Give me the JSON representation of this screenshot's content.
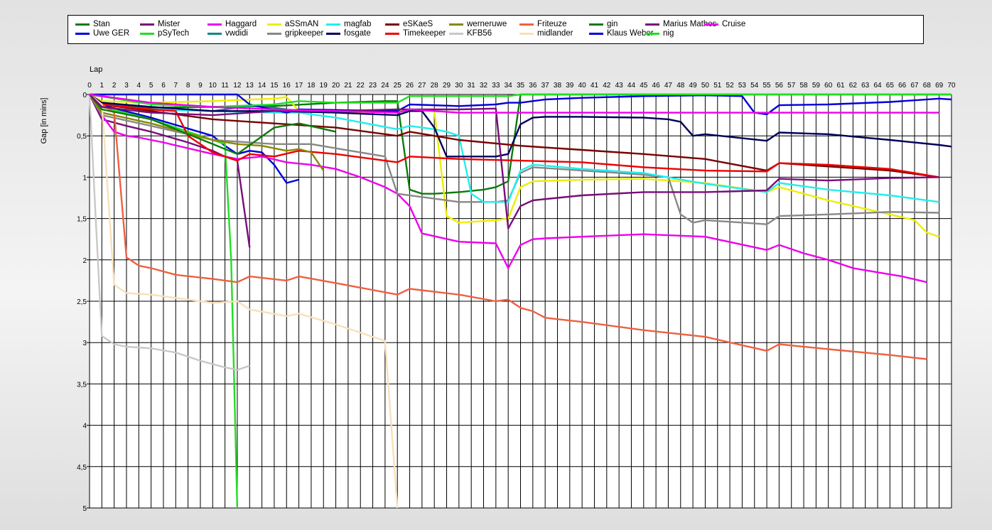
{
  "chart_data": {
    "type": "line",
    "title": "",
    "xlabel": "Lap",
    "ylabel": "Gap [in mins]",
    "x_ticks": [
      0,
      1,
      2,
      3,
      4,
      5,
      6,
      7,
      8,
      9,
      10,
      11,
      12,
      13,
      14,
      15,
      16,
      17,
      18,
      19,
      20,
      21,
      22,
      23,
      24,
      25,
      26,
      27,
      28,
      29,
      30,
      31,
      32,
      33,
      34,
      35,
      36,
      37,
      38,
      39,
      40,
      41,
      42,
      43,
      44,
      45,
      46,
      47,
      48,
      49,
      50,
      51,
      52,
      53,
      54,
      55,
      56,
      57,
      58,
      59,
      60,
      61,
      62,
      63,
      64,
      65,
      66,
      67,
      68,
      69,
      70
    ],
    "y_ticks": [
      "0",
      "0,5",
      "1",
      "1,5",
      "2",
      "2,5",
      "3",
      "3,5",
      "4",
      "4,5",
      "5"
    ],
    "y_tick_values": [
      0,
      0.5,
      1,
      1.5,
      2,
      2.5,
      3,
      3.5,
      4,
      4.5,
      5
    ],
    "xlim": [
      0,
      70
    ],
    "ylim": [
      0,
      5
    ],
    "y_inverted": true,
    "x_axis_position": "top",
    "grid": true,
    "legend_position": "top",
    "series": [
      {
        "name": "Stan",
        "color": "#0c7a0c",
        "x": [
          0,
          1,
          5,
          10,
          15,
          20,
          24,
          25,
          26,
          27,
          28,
          30,
          32,
          33,
          34,
          35,
          40,
          70
        ],
        "y": [
          0,
          0.1,
          0.16,
          0.15,
          0.14,
          0.1,
          0.08,
          0.08,
          1.15,
          1.2,
          1.2,
          1.18,
          1.15,
          1.12,
          1.05,
          0,
          0,
          0
        ]
      },
      {
        "name": "Uwe GER",
        "color": "#0000dd",
        "x": [
          0,
          1,
          5,
          10,
          11,
          12,
          13,
          14,
          15,
          16,
          17
        ],
        "y": [
          0,
          0.13,
          0.28,
          0.5,
          0.62,
          0.72,
          0.68,
          0.7,
          0.85,
          1.07,
          1.03
        ]
      },
      {
        "name": "Mister",
        "color": "#7a0d7a",
        "x": [
          0,
          1,
          3,
          5,
          8,
          10,
          11,
          12,
          13
        ],
        "y": [
          0,
          0.3,
          0.38,
          0.45,
          0.58,
          0.68,
          0.75,
          0.8,
          1.85
        ]
      },
      {
        "name": "pSyTech",
        "color": "#22dd22",
        "x": [
          0,
          1,
          5,
          10,
          11,
          11.5,
          12
        ],
        "y": [
          0,
          0.15,
          0.3,
          0.55,
          0.6,
          2,
          5
        ]
      },
      {
        "name": "Haggard",
        "color": "#ee00ee",
        "x": [
          0,
          1,
          2,
          3,
          4,
          6,
          8,
          10,
          12,
          14,
          16,
          18,
          20,
          22,
          24,
          25,
          26,
          27,
          30,
          33,
          34,
          35,
          36,
          37,
          40,
          45,
          50,
          55,
          56,
          58,
          60,
          62,
          64,
          66,
          68
        ],
        "y": [
          0,
          0.25,
          0.45,
          0.5,
          0.52,
          0.58,
          0.65,
          0.72,
          0.78,
          0.75,
          0.82,
          0.85,
          0.9,
          1,
          1.12,
          1.2,
          1.35,
          1.68,
          1.78,
          1.8,
          2.1,
          1.82,
          1.75,
          1.74,
          1.72,
          1.69,
          1.72,
          1.88,
          1.82,
          1.92,
          2,
          2.1,
          2.15,
          2.2,
          2.27
        ]
      },
      {
        "name": "vwdidi",
        "color": "#118888",
        "x": [
          0,
          1,
          5,
          10,
          13,
          15,
          16
        ],
        "y": [
          0,
          0.12,
          0.18,
          0.2,
          0.14,
          0.16,
          0.18
        ]
      },
      {
        "name": "aSSmAN",
        "color": "#eeee00",
        "x": [
          0,
          1,
          5,
          10,
          15,
          16,
          17,
          20,
          25,
          28,
          29,
          30,
          33,
          34,
          35,
          36,
          40,
          45,
          50,
          55,
          56,
          60,
          65,
          67,
          68,
          69
        ],
        "y": [
          0,
          0.08,
          0.1,
          0.08,
          0.05,
          0.03,
          0.2,
          0.22,
          0.2,
          0.2,
          1.47,
          1.55,
          1.52,
          1.5,
          1.12,
          1.05,
          1.03,
          1.02,
          1.07,
          1.18,
          1.12,
          1.28,
          1.45,
          1.52,
          1.67,
          1.72
        ]
      },
      {
        "name": "gripkeeper",
        "color": "#888888",
        "x": [
          0,
          1,
          5,
          10,
          15,
          18,
          20,
          24,
          25,
          30,
          33,
          34,
          35,
          36,
          40,
          45,
          47,
          48,
          49,
          50,
          55,
          56,
          60,
          65,
          69
        ],
        "y": [
          0,
          0.25,
          0.38,
          0.55,
          0.6,
          0.6,
          0.65,
          0.75,
          1.2,
          1.3,
          1.3,
          1.28,
          0.95,
          0.88,
          0.92,
          0.97,
          1,
          1.45,
          1.55,
          1.52,
          1.57,
          1.47,
          1.45,
          1.42,
          1.43
        ]
      },
      {
        "name": "magfab",
        "color": "#22eeee",
        "x": [
          0,
          1,
          5,
          10,
          15,
          17,
          20,
          25,
          26,
          28,
          29,
          30,
          31,
          32,
          33,
          34,
          35,
          36,
          37,
          40,
          45,
          50,
          55,
          56,
          60,
          65,
          69
        ],
        "y": [
          0,
          0.12,
          0.18,
          0.2,
          0.22,
          0.22,
          0.28,
          0.42,
          0.38,
          0.42,
          0.45,
          0.5,
          1.2,
          1.3,
          1.3,
          1.3,
          0.92,
          0.85,
          0.86,
          0.9,
          0.95,
          1.08,
          1.18,
          1.07,
          1.15,
          1.22,
          1.3
        ]
      },
      {
        "name": "fosgate",
        "color": "#00005a",
        "x": [
          0,
          1,
          5,
          10,
          15,
          20,
          25,
          26,
          27,
          28,
          29,
          30,
          33,
          34,
          35,
          36,
          37,
          40,
          45,
          47,
          48,
          49,
          50,
          55,
          56,
          60,
          65,
          69,
          70
        ],
        "y": [
          0,
          0.1,
          0.15,
          0.2,
          0.2,
          0.22,
          0.25,
          0.2,
          0.2,
          0.4,
          0.75,
          0.75,
          0.75,
          0.72,
          0.36,
          0.28,
          0.27,
          0.27,
          0.28,
          0.3,
          0.33,
          0.5,
          0.48,
          0.56,
          0.46,
          0.48,
          0.55,
          0.61,
          0.63
        ]
      },
      {
        "name": "eSKaeS",
        "color": "#7a0000",
        "x": [
          0,
          1,
          5,
          10,
          15,
          20,
          25,
          26,
          30,
          35,
          40,
          45,
          50,
          55,
          56,
          60,
          65,
          69
        ],
        "y": [
          0,
          0.12,
          0.2,
          0.3,
          0.35,
          0.4,
          0.5,
          0.45,
          0.55,
          0.62,
          0.67,
          0.72,
          0.78,
          0.92,
          0.83,
          0.87,
          0.92,
          1
        ]
      },
      {
        "name": "Timekeeper",
        "color": "#ee0000",
        "x": [
          0,
          1,
          5,
          7,
          8,
          10,
          12,
          13,
          15,
          17,
          20,
          25,
          26,
          30,
          35,
          40,
          45,
          50,
          55,
          56,
          60,
          65,
          69
        ],
        "y": [
          0,
          0.12,
          0.18,
          0.2,
          0.5,
          0.7,
          0.8,
          0.72,
          0.75,
          0.68,
          0.72,
          0.82,
          0.75,
          0.78,
          0.8,
          0.82,
          0.88,
          0.92,
          0.93,
          0.83,
          0.85,
          0.9,
          1
        ]
      },
      {
        "name": "werneruwe",
        "color": "#888800",
        "x": [
          0,
          1,
          5,
          10,
          12,
          14,
          16,
          17,
          18,
          19
        ],
        "y": [
          0,
          0.22,
          0.35,
          0.55,
          0.6,
          0.62,
          0.68,
          0.66,
          0.7,
          0.92
        ]
      },
      {
        "name": "KFB56",
        "color": "#c8c8c8",
        "x": [
          0,
          0.5,
          1,
          2,
          3,
          5,
          7,
          9,
          11,
          12,
          13
        ],
        "y": [
          0,
          1.5,
          2.92,
          3.02,
          3.05,
          3.07,
          3.12,
          3.22,
          3.3,
          3.33,
          3.28
        ]
      },
      {
        "name": "Friteuze",
        "color": "#f06040",
        "x": [
          0,
          1,
          2,
          3,
          4,
          5,
          7,
          10,
          12,
          13,
          16,
          17,
          20,
          25,
          26,
          30,
          33,
          34,
          35,
          36,
          37,
          40,
          45,
          50,
          55,
          56,
          60,
          65,
          68
        ],
        "y": [
          0,
          0.12,
          0.22,
          1.97,
          2.07,
          2.1,
          2.18,
          2.23,
          2.27,
          2.2,
          2.25,
          2.2,
          2.28,
          2.42,
          2.35,
          2.42,
          2.5,
          2.48,
          2.58,
          2.62,
          2.7,
          2.75,
          2.85,
          2.93,
          3.1,
          3.02,
          3.08,
          3.15,
          3.2
        ]
      },
      {
        "name": "midlander",
        "color": "#f8e0b8",
        "x": [
          0,
          1,
          2,
          3,
          5,
          10,
          12,
          13,
          16,
          17,
          20,
          24,
          25
        ],
        "y": [
          0,
          0.12,
          2.3,
          2.4,
          2.42,
          2.52,
          2.5,
          2.6,
          2.68,
          2.65,
          2.78,
          2.98,
          5
        ]
      },
      {
        "name": "gin",
        "color": "#0c7a0c",
        "x": [
          0,
          1,
          5,
          10,
          12,
          15,
          17,
          20
        ],
        "y": [
          0,
          0.18,
          0.3,
          0.6,
          0.72,
          0.4,
          0.35,
          0.45
        ]
      },
      {
        "name": "Klaus Weber",
        "color": "#0000dd",
        "x": [
          0,
          10,
          12,
          13,
          16,
          17,
          25,
          26,
          30,
          33,
          34,
          35,
          36,
          37,
          40,
          45,
          50,
          53,
          54,
          55,
          56,
          60,
          65,
          69,
          70
        ],
        "y": [
          0,
          0,
          0,
          0.12,
          0.22,
          0.18,
          0.2,
          0.12,
          0.14,
          0.12,
          0.1,
          0.1,
          0.08,
          0.06,
          0.04,
          0.02,
          0.01,
          0.02,
          0.22,
          0.24,
          0.13,
          0.12,
          0.09,
          0.05,
          0.06
        ]
      },
      {
        "name": "Marius Mathes",
        "color": "#7a0d7a",
        "x": [
          0,
          1,
          5,
          10,
          15,
          20,
          25,
          30,
          33,
          34,
          35,
          36,
          40,
          45,
          50,
          55,
          56,
          60,
          65,
          69
        ],
        "y": [
          0,
          0.15,
          0.22,
          0.25,
          0.2,
          0.2,
          0.18,
          0.18,
          0.17,
          1.62,
          1.35,
          1.28,
          1.22,
          1.18,
          1.18,
          1.16,
          1.02,
          1.04,
          1.01,
          1
        ]
      },
      {
        "name": "nig",
        "color": "#22dd22",
        "x": [
          0,
          5,
          10,
          15,
          17,
          20,
          25,
          26,
          30,
          34,
          35,
          70
        ],
        "y": [
          0,
          0.12,
          0.15,
          0.12,
          0.08,
          0.1,
          0.1,
          0.02,
          0.02,
          0.02,
          0,
          0
        ]
      },
      {
        "name": "Cruise",
        "color": "#ee00ee",
        "x": [
          0,
          5,
          10,
          15,
          20,
          25,
          26,
          28,
          30,
          33,
          34,
          35,
          36,
          37,
          40,
          45,
          50,
          55,
          56,
          60,
          65,
          69
        ],
        "y": [
          0,
          0.1,
          0.15,
          0.18,
          0.2,
          0.22,
          0.18,
          0.2,
          0.22,
          0.22,
          0.22,
          0.22,
          0.22,
          0.22,
          0.22,
          0.22,
          0.22,
          0.22,
          0.22,
          0.22,
          0.22,
          0.22
        ]
      }
    ]
  }
}
